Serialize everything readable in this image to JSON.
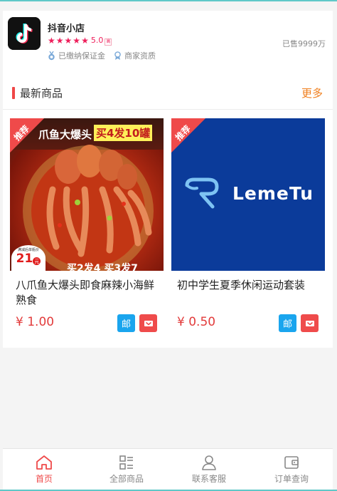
{
  "shop": {
    "name": "抖音小店",
    "rating": "5.0",
    "rating_tag": "高",
    "star_count": 5,
    "deposit_label": "已缴纳保证金",
    "qualification_label": "商家资质",
    "sold_label": "已售9999万"
  },
  "section": {
    "title": "最新商品",
    "more_label": "更多"
  },
  "products": [
    {
      "badge": "推荐",
      "title": "八爪鱼大爆头即食麻辣小海鲜熟食",
      "price": "¥ 1.00",
      "ship_label": "邮",
      "image_texts": {
        "banner": "爪鱼大爆头",
        "banner_tag": "买4发10罐",
        "price_small": "满减后单瓶价",
        "price_big": "21",
        "price_unit": "元",
        "bottom": "买2发4 买3发7"
      }
    },
    {
      "badge": "推荐",
      "title": "初中学生夏季休闲运动套装",
      "price": "¥ 0.50",
      "ship_label": "邮",
      "image_texts": {
        "brand": "LemeTu"
      }
    }
  ],
  "nav": [
    {
      "label": "首页",
      "icon": "home-icon",
      "active": true
    },
    {
      "label": "全部商品",
      "icon": "grid-list-icon",
      "active": false
    },
    {
      "label": "联系客服",
      "icon": "user-icon",
      "active": false
    },
    {
      "label": "订单查询",
      "icon": "wallet-icon",
      "active": false
    }
  ],
  "colors": {
    "accent_red": "#ef4a4a",
    "price_red": "#e23b3b",
    "more_orange": "#f07f1e",
    "ship_blue": "#1aa5ee",
    "star_pink": "#ee1f5b"
  }
}
